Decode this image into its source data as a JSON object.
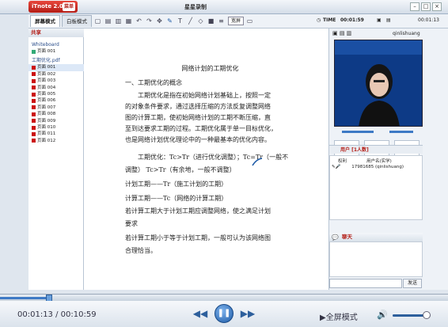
{
  "app": {
    "logo": "iTnote 2.0",
    "menu": "菜单",
    "title": "星星录制"
  },
  "toolbar": {
    "tab_whiteboard": "屏幕模式",
    "tab_board": "白板模式",
    "select_value": "宽屏"
  },
  "timer": {
    "label": "TIME",
    "elapsed": "00:01:59",
    "remain": "00:01:13"
  },
  "sidebar": {
    "header": "共享",
    "whiteboard_label": "Whiteboard",
    "whiteboard_item": "页面 001",
    "file_label": "工期优化.pdf",
    "pages": [
      "页面 001",
      "页面 002",
      "页面 003",
      "页面 004",
      "页面 005",
      "页面 006",
      "页面 007",
      "页面 008",
      "页面 009",
      "页面 010",
      "页面 011",
      "页面 012"
    ]
  },
  "doc": {
    "title": "网络计划的工期优化",
    "lines": [
      "一、工期优化的概念",
      "工期优化是指在初始网络计划基础上，按照一定",
      "的对象条件要求，通过选择压缩的方法反复调整网络",
      "图的计算工期，使初始网络计划的工期不断压缩，直",
      "至到达要求工期的过程。工期优化属于单一目标优化，",
      "也是网络计划优化理论中的一种最基本的优化内容。",
      "工期优化：Tc>Tr（进行优化调整）；Tc=Tr（一般不",
      "调整）  Tc>Tr（有余地，一般不调整）",
      "计划工期——Tr（施工计划的工期）",
      "计算工期——Tc（网络的计算工期）",
      "若计算工期大于计划工期应调整网络，使之满足计划",
      "要求",
      "若计算工期小于等于计划工期，一般可认为该网络图",
      "合理恰当。"
    ]
  },
  "right": {
    "user_name": "qinlishuang",
    "tnote": [
      "Tnote",
      "Tnote",
      "Tnote"
    ],
    "users_header": "用户 [1人数]",
    "col_role": "权利",
    "col_user": "用户名(实学)",
    "user_row": "17981685 (qinlishuang)",
    "chat_header": "聊天",
    "send": "发送"
  },
  "player": {
    "current": "00:01:13",
    "total": "00:10:59",
    "separator": " / ",
    "fullscreen": "全屏模式",
    "progress": 0.11,
    "volume": 0.9
  }
}
